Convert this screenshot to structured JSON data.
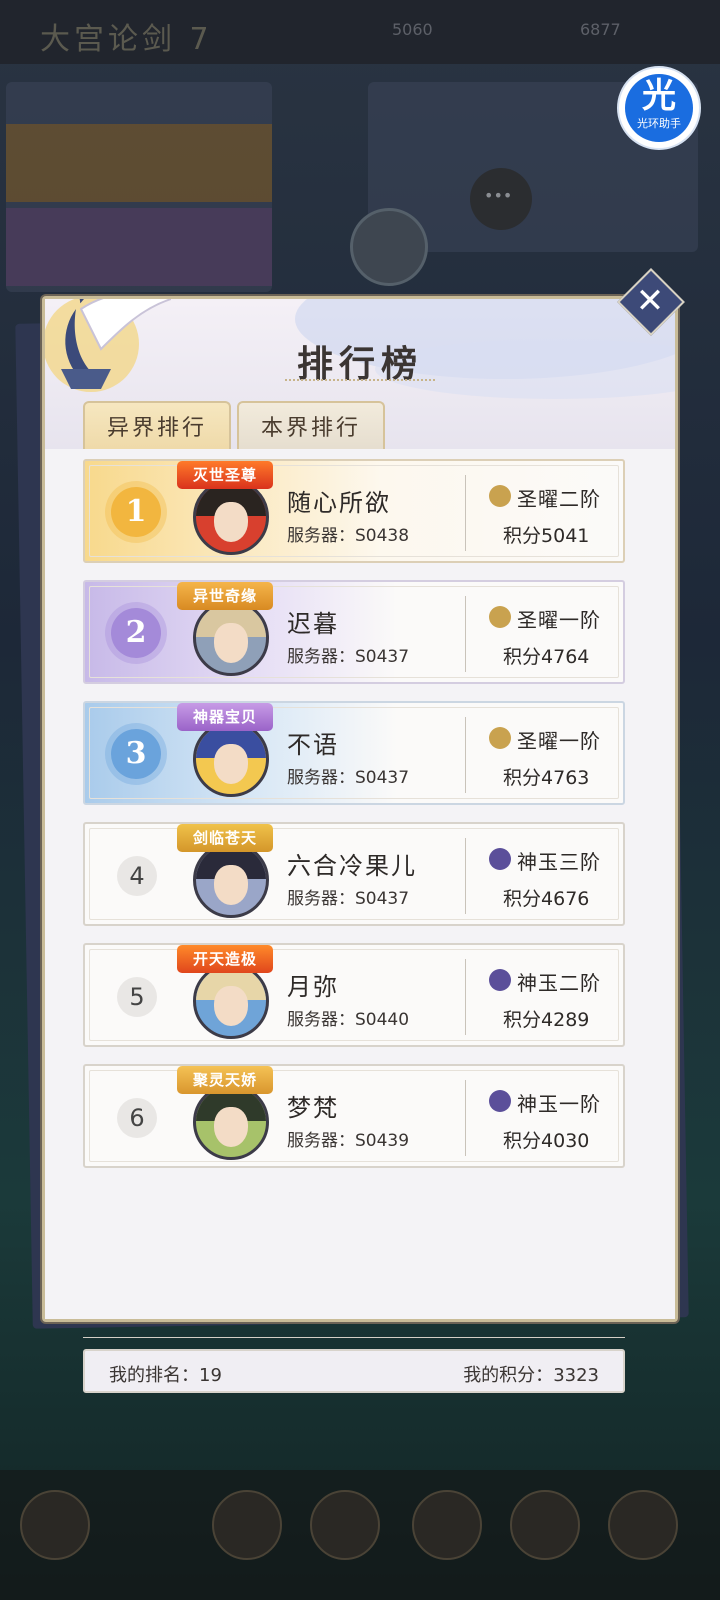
{
  "background": {
    "title": "大宫论剑",
    "title_num": "7",
    "res1": "5060",
    "res2": "6877"
  },
  "helper": {
    "glyph": "光",
    "label": "光环助手"
  },
  "modal": {
    "title": "排行榜",
    "close_glyph": "✕",
    "tabs": [
      {
        "label": "异界排行",
        "active": true
      },
      {
        "label": "本界排行",
        "active": false
      }
    ],
    "server_label": "服务器：",
    "score_label": "积分",
    "rows": [
      {
        "rank": "1",
        "badge": "灭世圣尊",
        "name": "随心所欲",
        "server": "S0438",
        "tier": "圣曜二阶",
        "score": "5041"
      },
      {
        "rank": "2",
        "badge": "异世奇缘",
        "name": "迟暮",
        "server": "S0437",
        "tier": "圣曜一阶",
        "score": "4764"
      },
      {
        "rank": "3",
        "badge": "神器宝贝",
        "name": "不语",
        "server": "S0437",
        "tier": "圣曜一阶",
        "score": "4763"
      },
      {
        "rank": "4",
        "badge": "剑临苍天",
        "name": "六合冷果儿",
        "server": "S0437",
        "tier": "神玉三阶",
        "score": "4676"
      },
      {
        "rank": "5",
        "badge": "开天造极",
        "name": "月弥",
        "server": "S0440",
        "tier": "神玉二阶",
        "score": "4289"
      },
      {
        "rank": "6",
        "badge": "聚灵天娇",
        "name": "梦梵",
        "server": "S0439",
        "tier": "神玉一阶",
        "score": "4030"
      }
    ],
    "my_rank_label": "我的排名：",
    "my_rank": "19",
    "my_score_label": "我的积分：",
    "my_score": "3323"
  },
  "colors": {
    "gold": "#f2b63f",
    "purple": "#a48ad9",
    "blue": "#6aa3dc",
    "tier_sheng": "#c9a24f",
    "tier_shen": "#5b4f9a"
  }
}
